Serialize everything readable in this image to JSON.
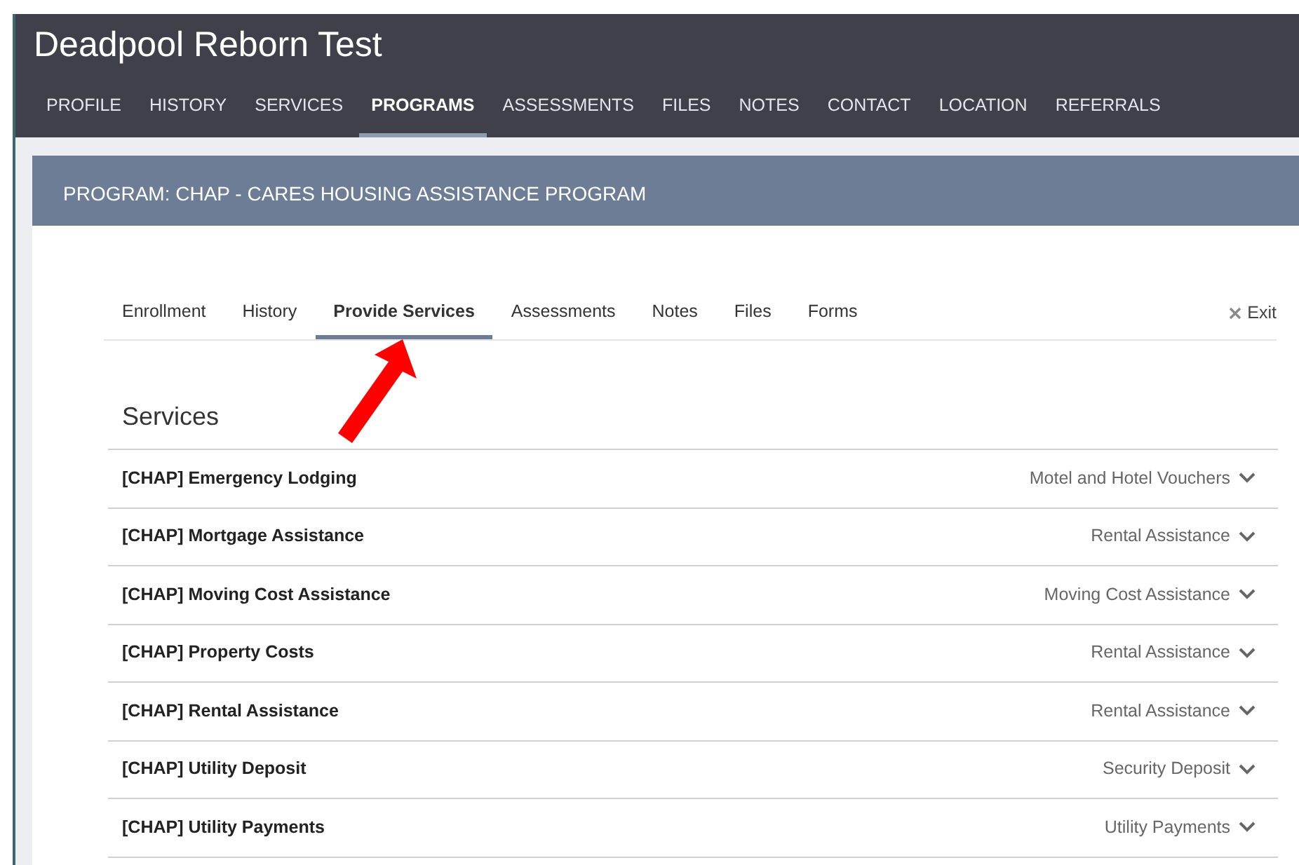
{
  "header": {
    "title": "Deadpool Reborn Test"
  },
  "nav": [
    {
      "label": "PROFILE",
      "selected": false
    },
    {
      "label": "HISTORY",
      "selected": false
    },
    {
      "label": "SERVICES",
      "selected": false
    },
    {
      "label": "PROGRAMS",
      "selected": true
    },
    {
      "label": "ASSESSMENTS",
      "selected": false
    },
    {
      "label": "FILES",
      "selected": false
    },
    {
      "label": "NOTES",
      "selected": false
    },
    {
      "label": "CONTACT",
      "selected": false
    },
    {
      "label": "LOCATION",
      "selected": false
    },
    {
      "label": "REFERRALS",
      "selected": false
    }
  ],
  "program_banner": {
    "title": "PROGRAM: CHAP - CARES HOUSING ASSISTANCE PROGRAM"
  },
  "tabs": [
    {
      "label": "Enrollment",
      "selected": false
    },
    {
      "label": "History",
      "selected": false
    },
    {
      "label": "Provide Services",
      "selected": true
    },
    {
      "label": "Assessments",
      "selected": false
    },
    {
      "label": "Notes",
      "selected": false
    },
    {
      "label": "Files",
      "selected": false
    },
    {
      "label": "Forms",
      "selected": false
    }
  ],
  "exit": {
    "label": "Exit"
  },
  "services": {
    "heading": "Services",
    "rows": [
      {
        "name": "[CHAP] Emergency Lodging",
        "category": "Motel and Hotel Vouchers",
        "expanded": false
      },
      {
        "name": "[CHAP] Mortgage Assistance",
        "category": "Rental Assistance",
        "expanded": false
      },
      {
        "name": "[CHAP] Moving Cost Assistance",
        "category": "Moving Cost Assistance",
        "expanded": false
      },
      {
        "name": "[CHAP] Property Costs",
        "category": "Rental Assistance",
        "expanded": false
      },
      {
        "name": "[CHAP] Rental Assistance",
        "category": "Rental Assistance",
        "expanded": false
      },
      {
        "name": "[CHAP] Utility Deposit",
        "category": "Security Deposit",
        "expanded": false
      },
      {
        "name": "[CHAP] Utility Payments",
        "category": "Utility Payments",
        "expanded": false
      }
    ]
  }
}
